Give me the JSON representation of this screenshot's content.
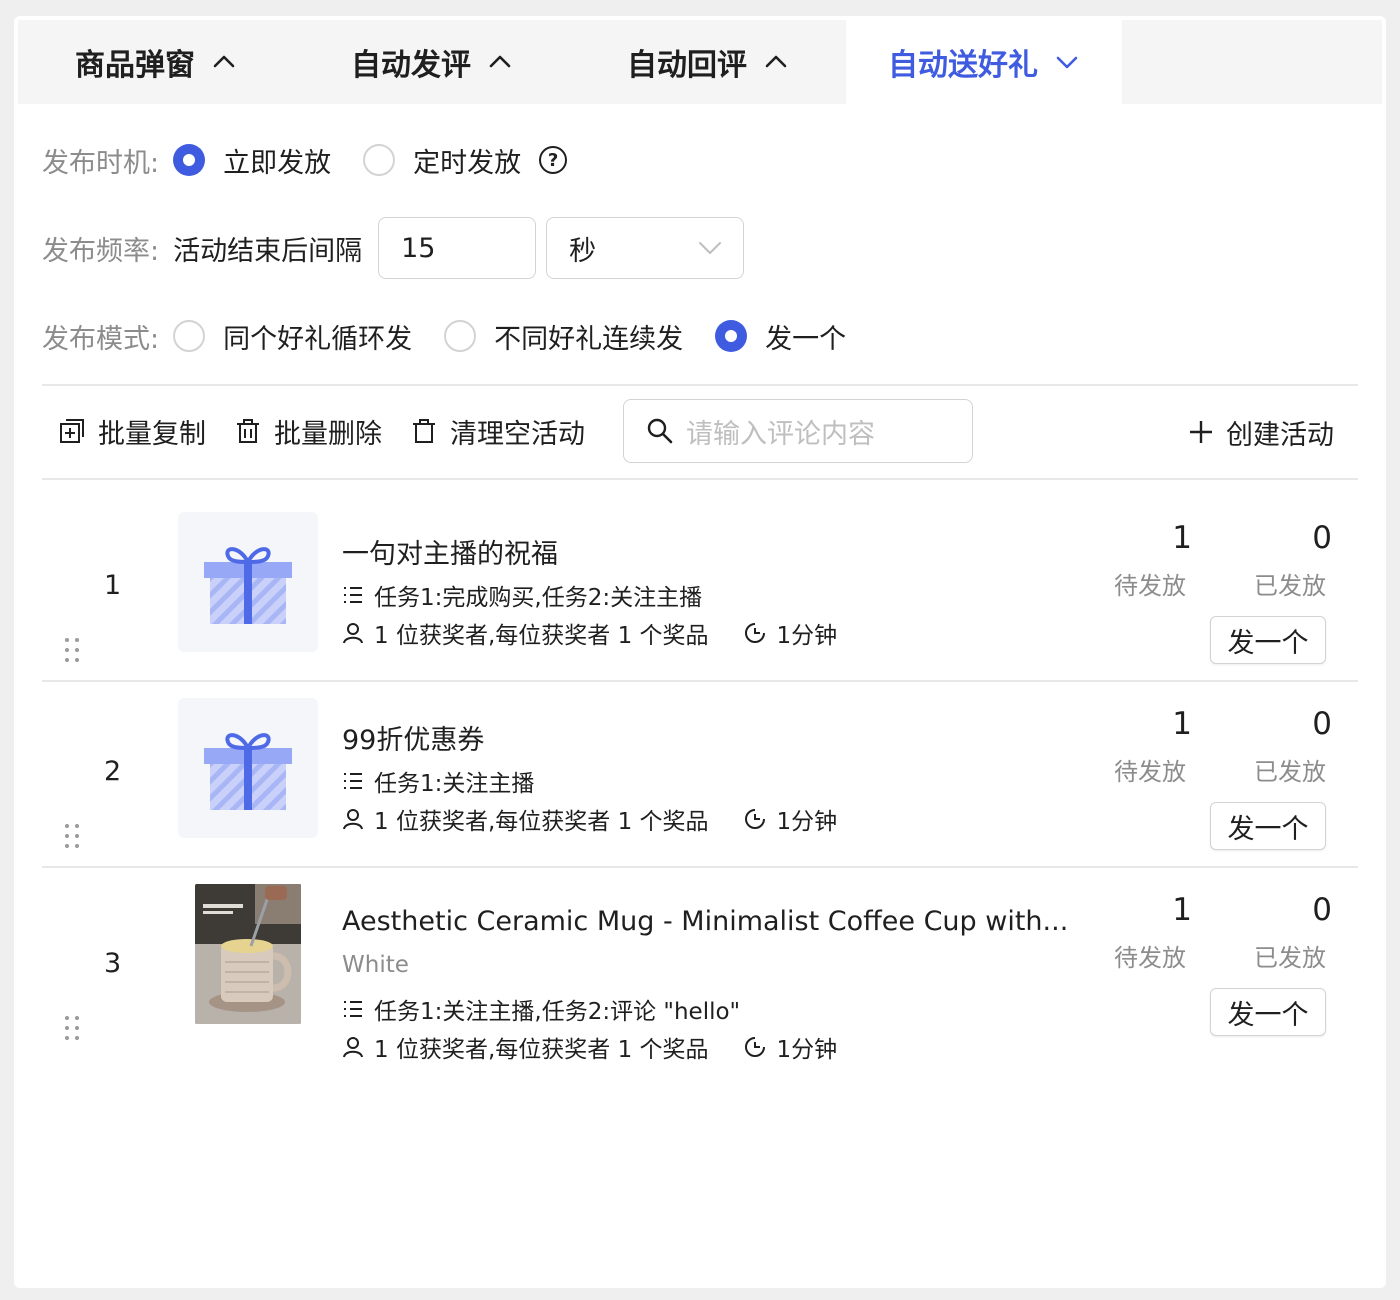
{
  "tabs": [
    {
      "label": "商品弹窗",
      "chevron": "up",
      "active": false
    },
    {
      "label": "自动发评",
      "chevron": "up",
      "active": false
    },
    {
      "label": "自动回评",
      "chevron": "up",
      "active": false
    },
    {
      "label": "自动送好礼",
      "chevron": "down",
      "active": true
    }
  ],
  "timing": {
    "label": "发布时机:",
    "options": [
      "立即发放",
      "定时发放"
    ],
    "selected": 0
  },
  "frequency": {
    "label": "发布频率:",
    "prefix": "活动结束后间隔",
    "value": "15",
    "unit": "秒"
  },
  "mode": {
    "label": "发布模式:",
    "options": [
      "同个好礼循环发",
      "不同好礼连续发",
      "发一个"
    ],
    "selected": 2
  },
  "toolbar": {
    "batch_copy": "批量复制",
    "batch_delete": "批量删除",
    "clear_empty": "清理空活动",
    "search_placeholder": "请输入评论内容",
    "create": "创建活动"
  },
  "items": [
    {
      "index": "1",
      "title": "一句对主播的祝福",
      "subtitle": "",
      "tasks": "任务1:完成购买,任务2:关注主播",
      "winners": "1 位获奖者,每位获奖者 1 个奖品",
      "duration": "1分钟",
      "pending": "1",
      "pending_label": "待发放",
      "sent": "0",
      "sent_label": "已发放",
      "action": "发一个",
      "thumb": "gift-icon"
    },
    {
      "index": "2",
      "title": "99折优惠券",
      "subtitle": "",
      "tasks": "任务1:关注主播",
      "winners": "1 位获奖者,每位获奖者 1 个奖品",
      "duration": "1分钟",
      "pending": "1",
      "pending_label": "待发放",
      "sent": "0",
      "sent_label": "已发放",
      "action": "发一个",
      "thumb": "gift-icon"
    },
    {
      "index": "3",
      "title": "Aesthetic Ceramic Mug - Minimalist Coffee Cup with...",
      "subtitle": "White",
      "tasks": "任务1:关注主播,任务2:评论 \"hello\"",
      "winners": "1 位获奖者,每位获奖者 1 个奖品",
      "duration": "1分钟",
      "pending": "1",
      "pending_label": "待发放",
      "sent": "0",
      "sent_label": "已发放",
      "action": "发一个",
      "thumb": "product-photo"
    }
  ],
  "colors": {
    "accent": "#3f5ce0",
    "muted": "#8c8c8c",
    "border": "#d3d3d3",
    "tabbar": "#f5f5f5"
  }
}
